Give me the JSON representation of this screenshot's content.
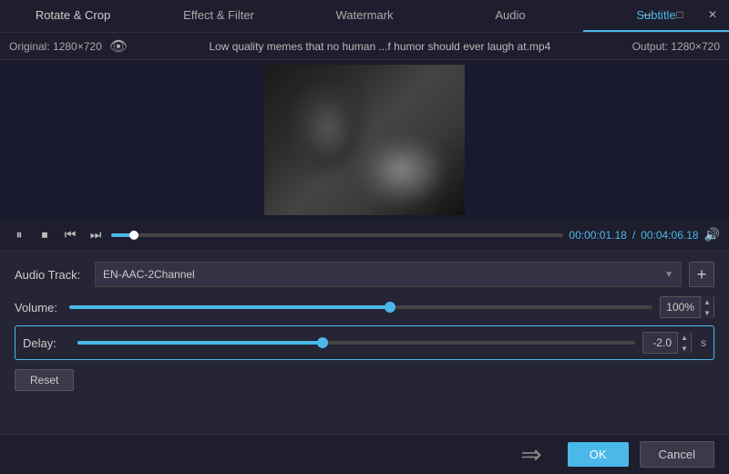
{
  "window": {
    "minimize_label": "─",
    "maximize_label": "□",
    "close_label": "✕"
  },
  "tabs": {
    "rotate_crop": "Rotate & Crop",
    "effect_filter": "Effect & Filter",
    "watermark": "Watermark",
    "audio": "Audio",
    "subtitle": "Subtitle"
  },
  "info_bar": {
    "original": "Original: 1280×720",
    "filename": "Low quality memes that no human ...f humor should ever laugh at.mp4",
    "output": "Output: 1280×720"
  },
  "playback": {
    "pause_icon": "⏸",
    "stop_icon": "⏹",
    "prev_icon": "⏮",
    "next_icon": "⏭",
    "current_time": "00:00:01.18",
    "separator": "/",
    "total_time": "00:04:06.18",
    "progress_percent": 5,
    "volume_icon": "🔊"
  },
  "audio_track": {
    "label": "Audio Track:",
    "value": "EN-AAC-2Channel",
    "add_icon": "+"
  },
  "volume": {
    "label": "Volume:",
    "value": "100%",
    "percent": 55
  },
  "delay": {
    "label": "Delay:",
    "value": "-2.0",
    "unit": "s",
    "percent": 44
  },
  "reset": {
    "label": "Reset"
  },
  "footer": {
    "ok_label": "OK",
    "cancel_label": "Cancel"
  }
}
